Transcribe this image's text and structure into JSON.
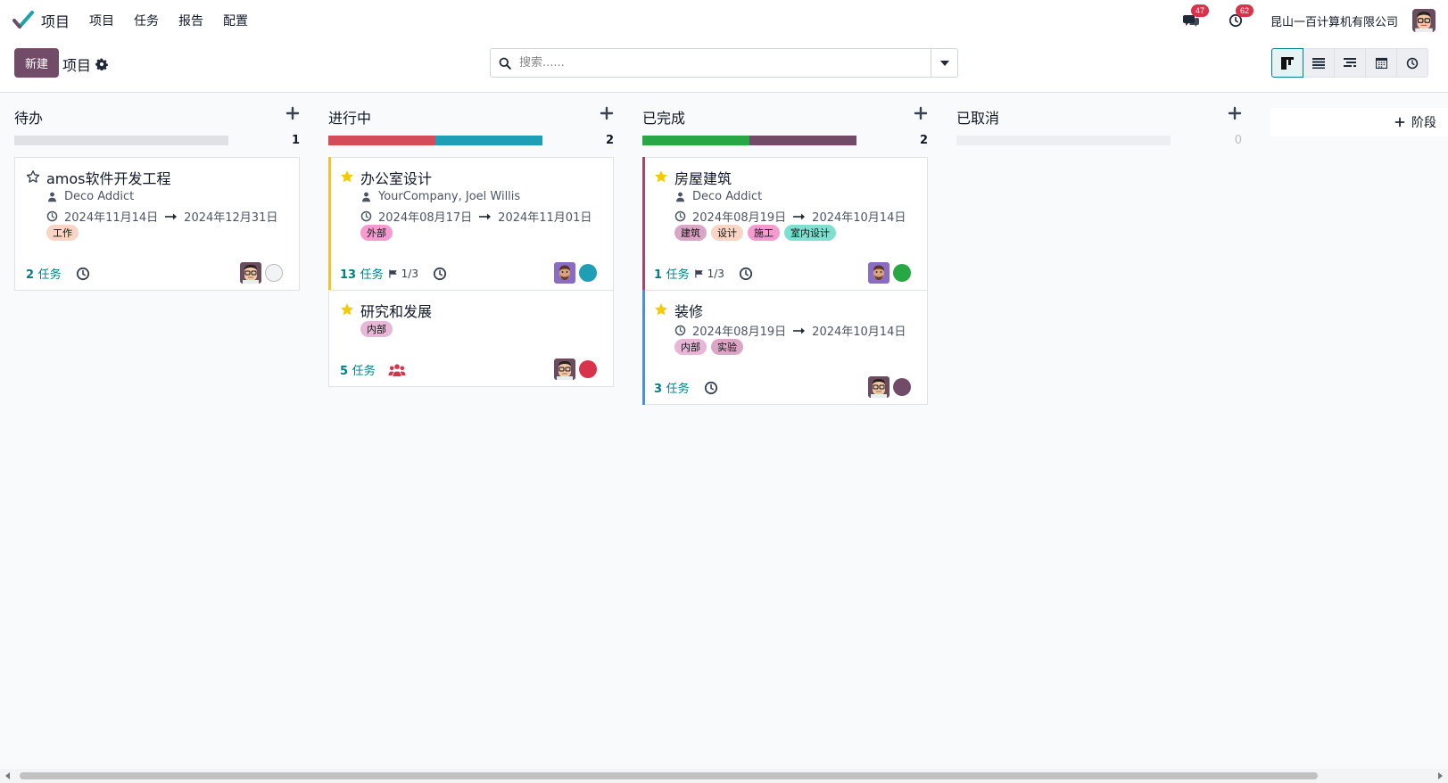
{
  "navbar": {
    "app_name": "项目",
    "menu": [
      "项目",
      "任务",
      "报告",
      "配置"
    ],
    "messages_count": "47",
    "activities_count": "62",
    "company": "昆山一百计算机有限公司"
  },
  "control": {
    "new_label": "新建",
    "breadcrumb": "项目",
    "search_placeholder": "搜索......"
  },
  "colors": {
    "primary": "#714b67",
    "link": "#017e84",
    "star": "#f3cc00"
  },
  "columns": [
    {
      "title": "待办",
      "count": "1",
      "cards": [
        {
          "name": "amos软件开发工程",
          "starred": false,
          "customer": "Deco Addict",
          "date_start": "2024年11月14日",
          "date_end": "2024年12月31日",
          "tags": [
            "工作"
          ],
          "tasks_count": "2",
          "tasks_label": "任务",
          "status": "grey"
        }
      ]
    },
    {
      "title": "进行中",
      "count": "2",
      "cards": [
        {
          "name": "办公室设计",
          "starred": true,
          "customer": "YourCompany, Joel Willis",
          "date_start": "2024年08月17日",
          "date_end": "2024年11月01日",
          "tags": [
            "外部"
          ],
          "tasks_count": "13",
          "tasks_label": "任务",
          "milestone": "1/3",
          "status": "blue"
        },
        {
          "name": "研究和发展",
          "starred": true,
          "tags": [
            "内部"
          ],
          "tasks_count": "5",
          "tasks_label": "任务",
          "status": "red"
        }
      ]
    },
    {
      "title": "已完成",
      "count": "2",
      "cards": [
        {
          "name": "房屋建筑",
          "starred": true,
          "customer": "Deco Addict",
          "date_start": "2024年08月19日",
          "date_end": "2024年10月14日",
          "tags": [
            "建筑",
            "设计",
            "施工",
            "室内设计"
          ],
          "tasks_count": "1",
          "tasks_label": "任务",
          "milestone": "1/3",
          "status": "green"
        },
        {
          "name": "装修",
          "starred": true,
          "date_start": "2024年08月19日",
          "date_end": "2024年10月14日",
          "tags": [
            "内部",
            "实验"
          ],
          "tasks_count": "3",
          "tasks_label": "任务",
          "status": "purple"
        }
      ]
    },
    {
      "title": "已取消",
      "count": "0",
      "cards": []
    }
  ],
  "add_stage_label": "阶段"
}
